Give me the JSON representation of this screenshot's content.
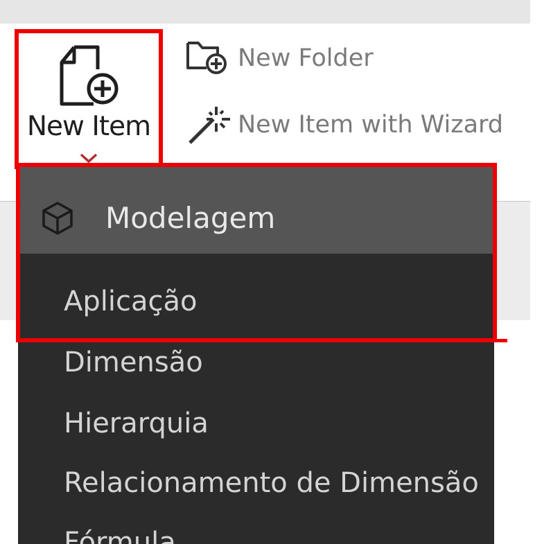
{
  "toolbar": {
    "new_item_label": "New Item",
    "new_folder_label": "New Folder",
    "new_wizard_label": "New Item with Wizard"
  },
  "menu": {
    "header_label": "Modelagem",
    "items": [
      {
        "label": "Aplicação"
      },
      {
        "label": "Dimensão"
      },
      {
        "label": "Hierarquia"
      },
      {
        "label": "Relacionamento de Dimensão"
      },
      {
        "label": "Fórmula"
      }
    ]
  },
  "icons": {
    "new_item": "document-plus-icon",
    "new_folder": "folder-plus-icon",
    "new_wizard": "magic-wand-icon",
    "chevron": "chevron-down-icon",
    "modelagem": "cube-icon"
  },
  "colors": {
    "highlight": "#ee0000",
    "menu_bg": "#2b2b2b",
    "menu_header_bg": "#555555"
  }
}
